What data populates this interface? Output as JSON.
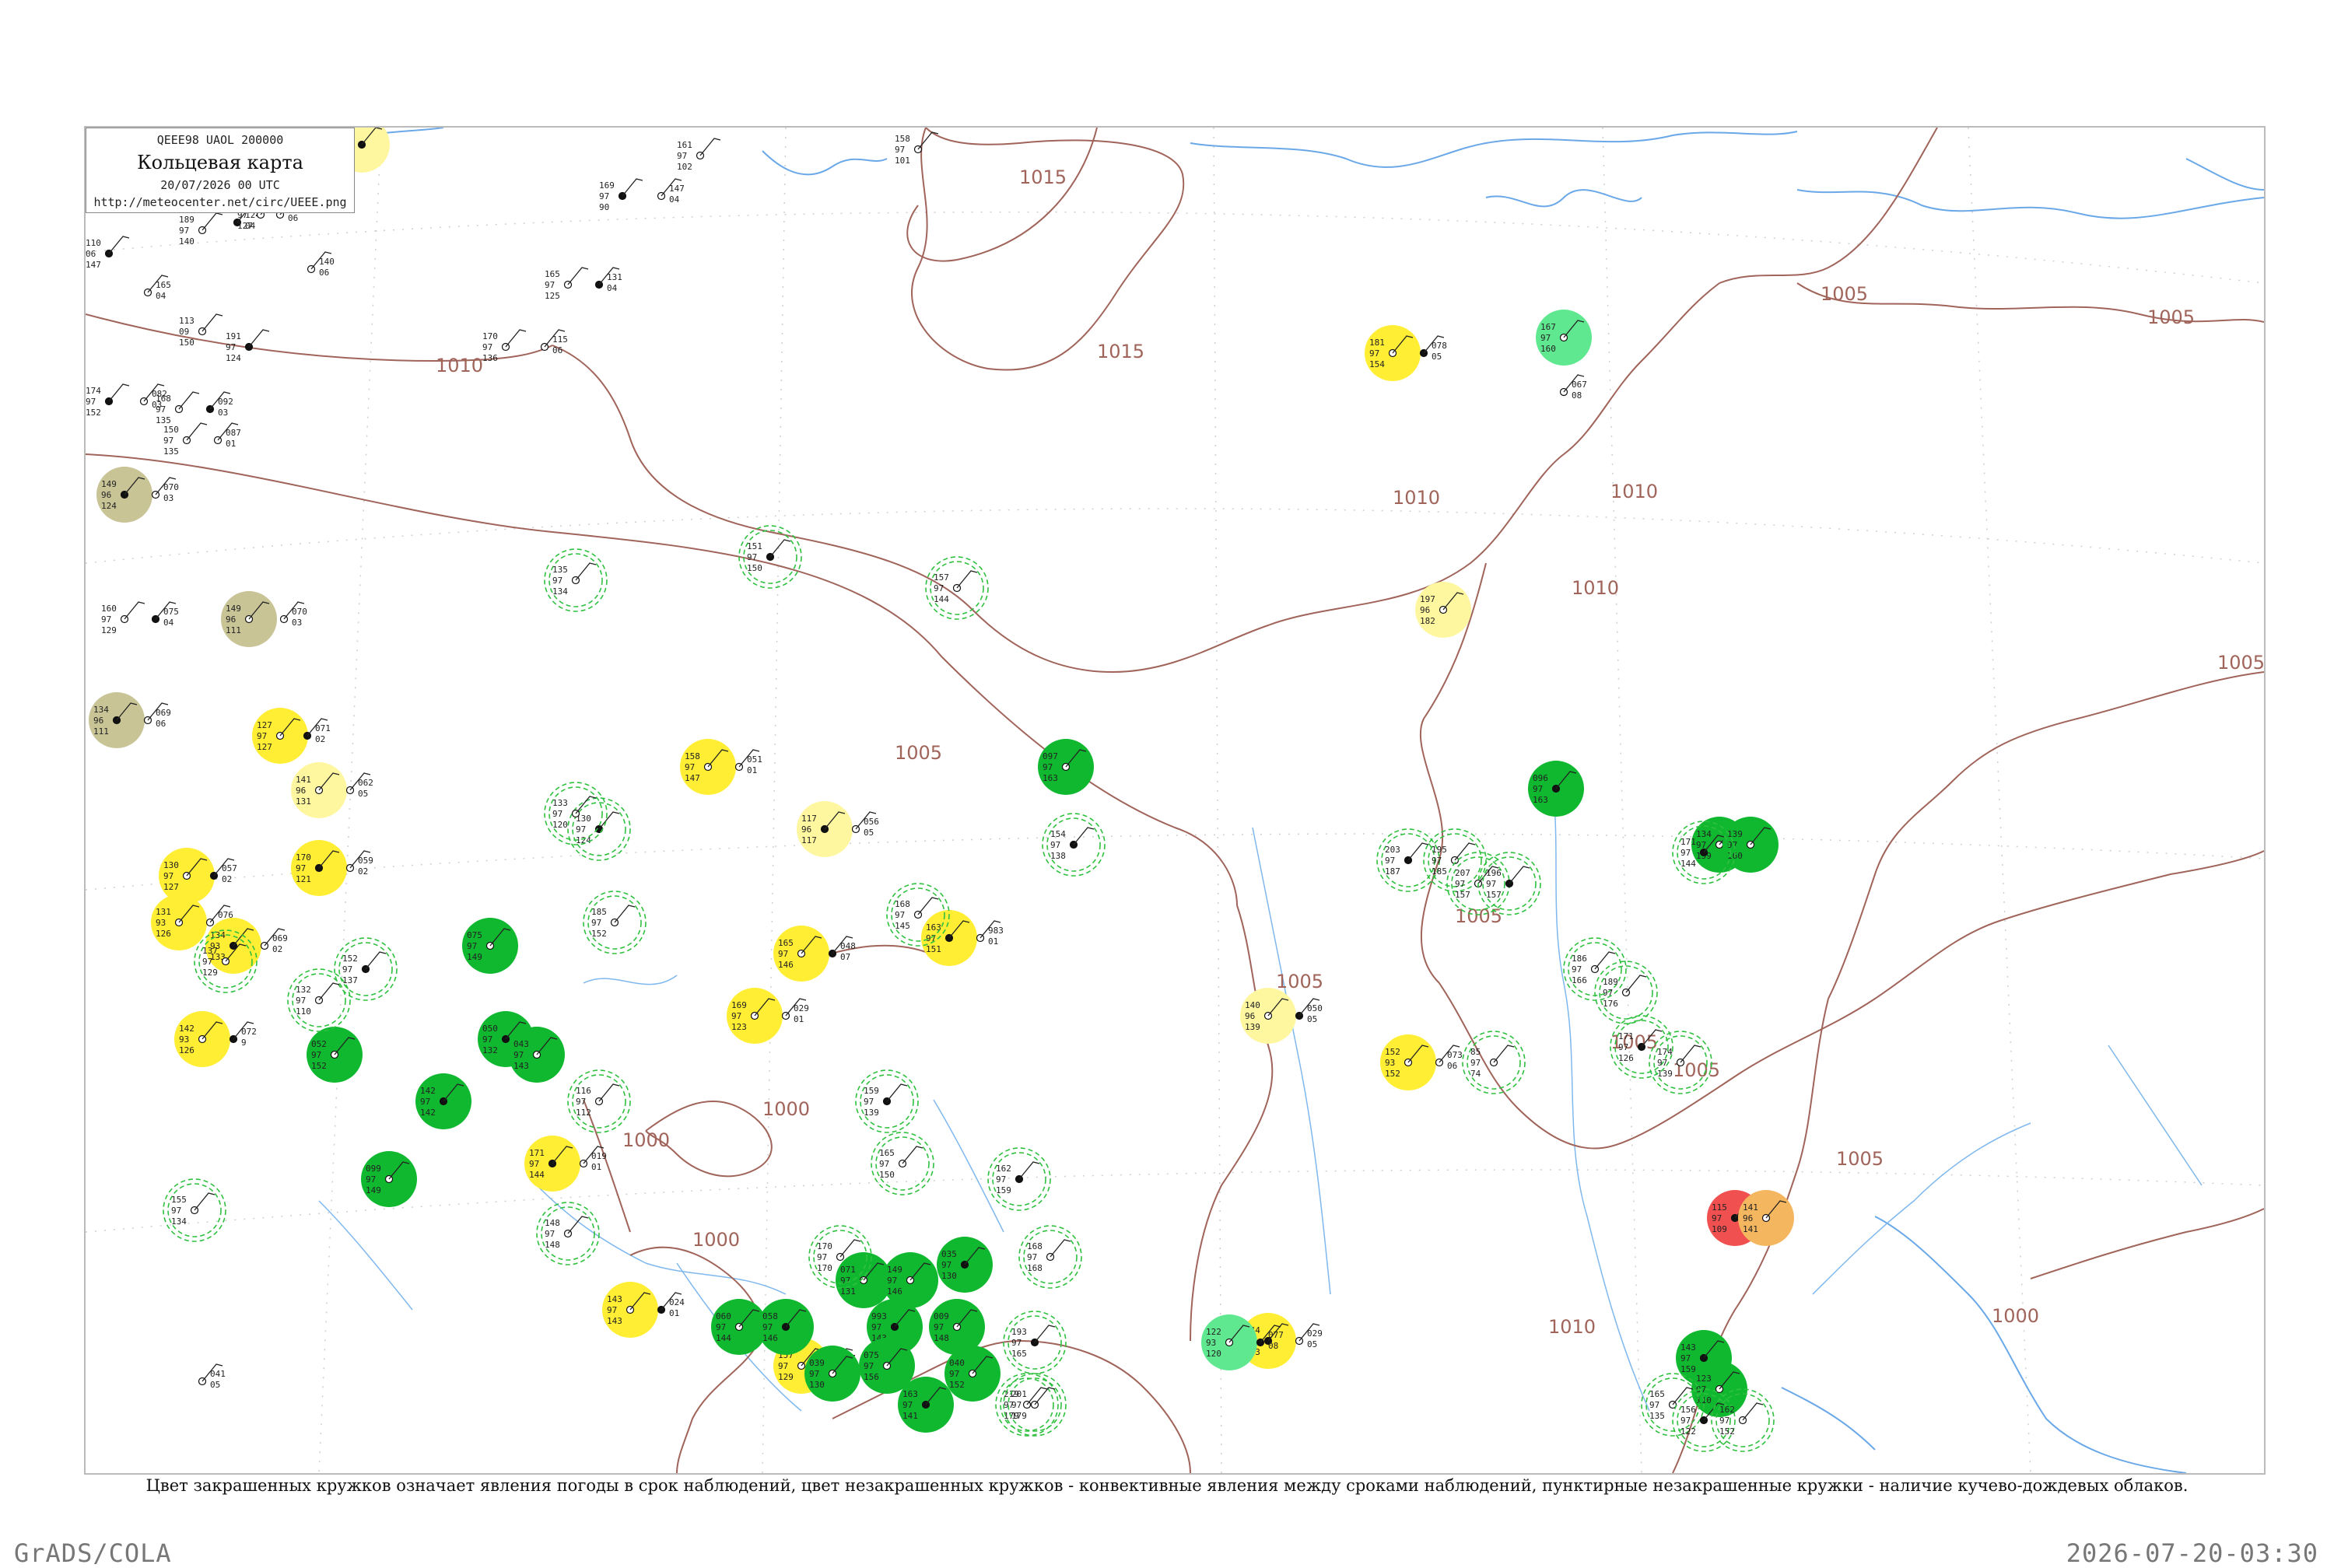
{
  "legend": {
    "header": "QEEE98  UAOL  200000",
    "title": "Кольцевая карта",
    "datetime": "20/07/2026 00 UTC",
    "url": "http://meteocenter.net/circ/UEEE.png"
  },
  "caption": "Цвет закрашенных кружков означает явления погоды в срок наблюдений, цвет незакрашенных кружков - конвективные явления между сроками наблюдений, пунктирные незакрашенные кружки - наличие кучево-дождевых облаков.",
  "footer": {
    "left": "GrADS/COLA",
    "right": "2026-07-20-03:30"
  },
  "colors": {
    "coast": "#6aa8e8",
    "isobar": "#a0645a",
    "grid": "#c8c8c8",
    "green_fill": "#10b830",
    "yellow_fill": "#ffee33",
    "pale_yellow_fill": "#fff7a0",
    "olive_fill": "#c8c496",
    "red_fill": "#f05050",
    "orange_fill": "#f5b660",
    "mint_fill": "#60e890",
    "cb_dash": "#30c040"
  },
  "isobars": [
    "1015",
    "1015",
    "1010",
    "1010",
    "1010",
    "1010",
    "1005",
    "1005",
    "1005",
    "1005",
    "1005",
    "1005",
    "1005",
    "1005",
    "1005",
    "1000",
    "1000",
    "1000",
    "1010",
    "1000"
  ],
  "stations": [
    {
      "v": [
        "146",
        "97",
        "06"
      ],
      "fill": "pale"
    },
    {
      "v": [
        "161",
        "97",
        "102"
      ]
    },
    {
      "v": [
        "158",
        "97",
        "101"
      ]
    },
    {
      "v": [
        "169",
        "97",
        "90"
      ]
    },
    {
      "v": [
        "147",
        "04"
      ]
    },
    {
      "v": [
        "189",
        "97",
        "140"
      ]
    },
    {
      "v": [
        "124",
        "04"
      ]
    },
    {
      "v": [
        "161",
        "97",
        "127"
      ]
    },
    {
      "v": [
        "155",
        "06"
      ]
    },
    {
      "v": [
        "110",
        "06",
        "147"
      ]
    },
    {
      "v": [
        "165",
        "04"
      ]
    },
    {
      "v": [
        "113",
        "09",
        "150"
      ]
    },
    {
      "v": [
        "191",
        "97",
        "124"
      ]
    },
    {
      "v": [
        "140",
        "06"
      ]
    },
    {
      "v": [
        "165",
        "97",
        "125"
      ]
    },
    {
      "v": [
        "131",
        "04"
      ]
    },
    {
      "v": [
        "170",
        "97",
        "136"
      ]
    },
    {
      "v": [
        "115",
        "06"
      ]
    },
    {
      "v": [
        "174",
        "97",
        "152"
      ]
    },
    {
      "v": [
        "082",
        "03"
      ]
    },
    {
      "v": [
        "168",
        "97",
        "135"
      ]
    },
    {
      "v": [
        "092",
        "03"
      ]
    },
    {
      "v": [
        "150",
        "97",
        "135"
      ]
    },
    {
      "v": [
        "087",
        "01"
      ]
    },
    {
      "v": [
        "149",
        "96",
        "124"
      ],
      "fill": "olive"
    },
    {
      "v": [
        "070",
        "03"
      ]
    },
    {
      "v": [
        "160",
        "97",
        "129"
      ]
    },
    {
      "v": [
        "075",
        "04"
      ]
    },
    {
      "v": [
        "149",
        "96",
        "111"
      ],
      "fill": "olive"
    },
    {
      "v": [
        "070",
        "03"
      ]
    },
    {
      "v": [
        "134",
        "96",
        "111"
      ],
      "fill": "olive"
    },
    {
      "v": [
        "069",
        "06"
      ]
    },
    {
      "v": [
        "127",
        "97",
        "127"
      ],
      "fill": "yellow"
    },
    {
      "v": [
        "071",
        "02"
      ]
    },
    {
      "v": [
        "141",
        "96",
        "131"
      ],
      "fill": "pale"
    },
    {
      "v": [
        "062",
        "05"
      ]
    },
    {
      "v": [
        "170",
        "97",
        "121"
      ],
      "fill": "yellow"
    },
    {
      "v": [
        "059",
        "02"
      ]
    },
    {
      "v": [
        "130",
        "97",
        "127"
      ],
      "fill": "yellow"
    },
    {
      "v": [
        "057",
        "02"
      ]
    },
    {
      "v": [
        "131",
        "93",
        "126"
      ],
      "fill": "yellow"
    },
    {
      "v": [
        "076",
        "02"
      ]
    },
    {
      "v": [
        "134",
        "93",
        "133"
      ],
      "fill": "yellow"
    },
    {
      "v": [
        "069",
        "02"
      ]
    },
    {
      "v": [
        "142",
        "93",
        "126"
      ],
      "fill": "yellow"
    },
    {
      "v": [
        "072",
        "9"
      ]
    },
    {
      "v": [
        "158",
        "97",
        "147"
      ],
      "fill": "yellow"
    },
    {
      "v": [
        "051",
        "01"
      ]
    },
    {
      "v": [
        "117",
        "96",
        "117"
      ],
      "fill": "pale"
    },
    {
      "v": [
        "056",
        "05"
      ]
    },
    {
      "v": [
        "165",
        "97",
        "146"
      ],
      "fill": "yellow"
    },
    {
      "v": [
        "048",
        "07"
      ]
    },
    {
      "v": [
        "169",
        "97",
        "123"
      ],
      "fill": "yellow"
    },
    {
      "v": [
        "029",
        "01"
      ]
    },
    {
      "v": [
        "171",
        "97",
        "144"
      ],
      "fill": "yellow"
    },
    {
      "v": [
        "019",
        "01"
      ]
    },
    {
      "v": [
        "143",
        "97",
        "143"
      ],
      "fill": "yellow"
    },
    {
      "v": [
        "024",
        "01"
      ]
    },
    {
      "v": [
        "157",
        "97",
        "129"
      ],
      "fill": "yellow"
    },
    {
      "v": [
        "007",
        "01"
      ]
    },
    {
      "v": [
        "163",
        "97",
        "151"
      ],
      "fill": "yellow"
    },
    {
      "v": [
        "983",
        "01"
      ]
    },
    {
      "v": [
        "140",
        "96",
        "139"
      ],
      "fill": "pale"
    },
    {
      "v": [
        "050",
        "05"
      ]
    },
    {
      "v": [
        "152",
        "93",
        "152"
      ],
      "fill": "yellow"
    },
    {
      "v": [
        "073",
        "06"
      ]
    },
    {
      "v": [
        "144",
        "97",
        "143"
      ],
      "fill": "yellow"
    },
    {
      "v": [
        "029",
        "05"
      ]
    },
    {
      "v": [
        "181",
        "97",
        "154"
      ],
      "fill": "yellow"
    },
    {
      "v": [
        "078",
        "05"
      ]
    },
    {
      "v": [
        "197",
        "96",
        "182"
      ],
      "fill": "pale"
    },
    {
      "v": [
        "041",
        "05"
      ]
    },
    {
      "v": [
        "115",
        "97",
        "109"
      ],
      "fill": "red"
    },
    {
      "v": [
        "141",
        "96",
        "141"
      ],
      "fill": "orange"
    },
    {
      "v": [
        "122",
        "93",
        "120"
      ],
      "fill": "mint"
    },
    {
      "v": [
        "077",
        "08"
      ]
    },
    {
      "v": [
        "167",
        "97",
        "160"
      ],
      "fill": "mint"
    },
    {
      "v": [
        "067",
        "08"
      ]
    },
    {
      "v": [
        "096",
        "97",
        "163"
      ],
      "fill": "green"
    },
    {
      "v": [
        "097",
        "97",
        "163"
      ],
      "fill": "green"
    },
    {
      "v": [
        "075",
        "97",
        "149"
      ],
      "fill": "green"
    },
    {
      "v": [
        "142",
        "97",
        "142"
      ],
      "fill": "green"
    },
    {
      "v": [
        "099",
        "97",
        "149"
      ],
      "fill": "green"
    },
    {
      "v": [
        "052",
        "97",
        "152"
      ],
      "fill": "green"
    },
    {
      "v": [
        "050",
        "97",
        "132"
      ],
      "fill": "green"
    },
    {
      "v": [
        "043",
        "97",
        "143"
      ],
      "fill": "green"
    },
    {
      "v": [
        "060",
        "97",
        "144"
      ],
      "fill": "green"
    },
    {
      "v": [
        "058",
        "97",
        "146"
      ],
      "fill": "green"
    },
    {
      "v": [
        "039",
        "97",
        "130"
      ],
      "fill": "green"
    },
    {
      "v": [
        "071",
        "97",
        "131"
      ],
      "fill": "green"
    },
    {
      "v": [
        "993",
        "97",
        "143"
      ],
      "fill": "green"
    },
    {
      "v": [
        "149",
        "97",
        "146"
      ],
      "fill": "green"
    },
    {
      "v": [
        "075",
        "97",
        "156"
      ],
      "fill": "green"
    },
    {
      "v": [
        "035",
        "97",
        "130"
      ],
      "fill": "green"
    },
    {
      "v": [
        "009",
        "97",
        "148"
      ],
      "fill": "green"
    },
    {
      "v": [
        "040",
        "97",
        "152"
      ],
      "fill": "green"
    },
    {
      "v": [
        "163",
        "97",
        "141"
      ],
      "fill": "green"
    },
    {
      "v": [
        "134",
        "97",
        "159"
      ],
      "fill": "green"
    },
    {
      "v": [
        "139",
        "97",
        "160"
      ],
      "fill": "green"
    },
    {
      "v": [
        "143",
        "97",
        "159"
      ],
      "fill": "green"
    },
    {
      "v": [
        "123",
        "97",
        "110"
      ],
      "fill": "green"
    },
    {
      "v": [
        "165",
        "97",
        "135"
      ],
      "cb": true
    },
    {
      "v": [
        "156",
        "97",
        "122"
      ],
      "cb": true
    },
    {
      "v": [
        "162",
        "97",
        "152"
      ],
      "cb": true
    },
    {
      "v": [
        "155",
        "97",
        "134"
      ],
      "cb": true
    },
    {
      "v": [
        "151",
        "97",
        "150"
      ],
      "cb": true
    },
    {
      "v": [
        "157",
        "97",
        "144"
      ],
      "cb": true
    },
    {
      "v": [
        "135",
        "97",
        "134"
      ],
      "cb": true
    },
    {
      "v": [
        "130",
        "97",
        "124"
      ],
      "cb": true
    },
    {
      "v": [
        "133",
        "97",
        "120"
      ],
      "cb": true
    },
    {
      "v": [
        "185",
        "97",
        "152"
      ],
      "cb": true
    },
    {
      "v": [
        "152",
        "97",
        "137"
      ],
      "cb": true
    },
    {
      "v": [
        "132",
        "97",
        "110"
      ],
      "cb": true
    },
    {
      "v": [
        "137",
        "97",
        "129"
      ],
      "cb": true
    },
    {
      "v": [
        "154",
        "97",
        "138"
      ],
      "cb": true
    },
    {
      "v": [
        "168",
        "97",
        "145"
      ],
      "cb": true
    },
    {
      "v": [
        "116",
        "97",
        "112"
      ],
      "cb": true
    },
    {
      "v": [
        "159",
        "97",
        "139"
      ],
      "cb": true
    },
    {
      "v": [
        "165",
        "97",
        "150"
      ],
      "cb": true
    },
    {
      "v": [
        "168",
        "97",
        "168"
      ],
      "cb": true
    },
    {
      "v": [
        "162",
        "97",
        "159"
      ],
      "cb": true
    },
    {
      "v": [
        "148",
        "97",
        "148"
      ],
      "cb": true
    },
    {
      "v": [
        "170",
        "97",
        "170"
      ],
      "cb": true
    },
    {
      "v": [
        "193",
        "97",
        "165"
      ],
      "cb": true
    },
    {
      "v": [
        "219",
        "97",
        "179"
      ],
      "cb": true
    },
    {
      "v": [
        "201",
        "97",
        "179"
      ],
      "cb": true
    },
    {
      "v": [
        "203",
        "97",
        "187"
      ],
      "cb": true
    },
    {
      "v": [
        "195",
        "97",
        "185"
      ],
      "cb": true
    },
    {
      "v": [
        "207",
        "97",
        "157"
      ],
      "cb": true
    },
    {
      "v": [
        "196",
        "97",
        "157"
      ],
      "cb": true
    },
    {
      "v": [
        "186",
        "97",
        "166"
      ],
      "cb": true
    },
    {
      "v": [
        "189",
        "97",
        "176"
      ],
      "cb": true
    },
    {
      "v": [
        "171",
        "97",
        "126"
      ],
      "cb": true
    },
    {
      "v": [
        "174",
        "97",
        "139"
      ],
      "cb": true
    },
    {
      "v": [
        "85",
        "97",
        "74"
      ],
      "cb": true
    },
    {
      "v": [
        "171",
        "97",
        "144"
      ],
      "cb": true
    }
  ]
}
